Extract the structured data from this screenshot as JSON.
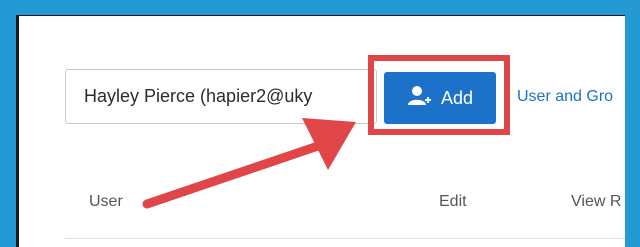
{
  "user_picker": {
    "value": "Hayley Pierce (hapier2@uky"
  },
  "add_button": {
    "label": "Add",
    "icon": "add-user-icon"
  },
  "link": {
    "label": "User and Gro"
  },
  "table": {
    "columns": [
      "User",
      "Edit",
      "View R"
    ]
  },
  "annotations": {
    "highlight_color": "#e04548",
    "arrow_color": "#e04548"
  },
  "colors": {
    "accent": "#1b72c8",
    "background": "#2499d3"
  }
}
